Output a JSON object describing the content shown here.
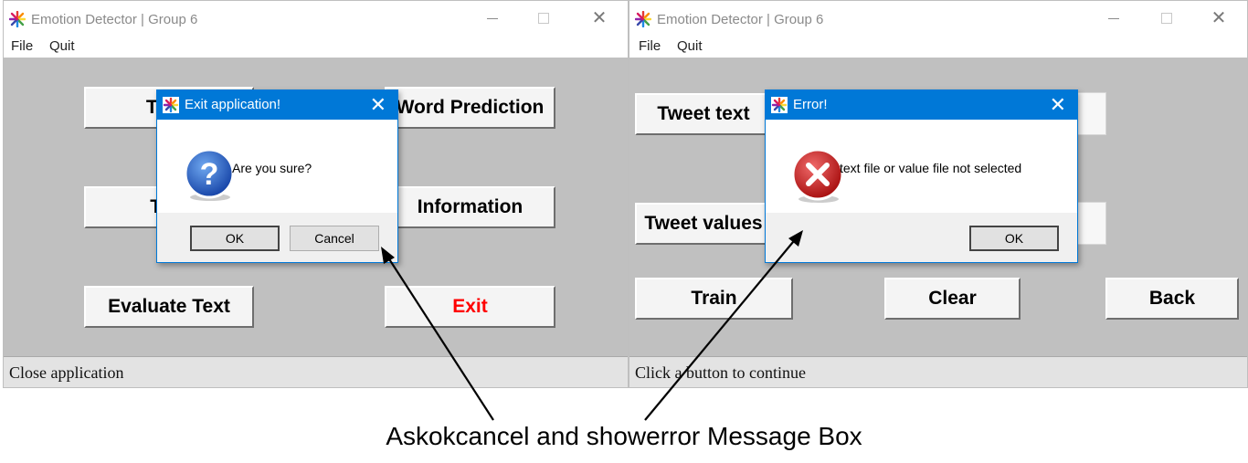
{
  "left_window": {
    "title": "Emotion Detector | Group 6",
    "menu": [
      "File",
      "Quit"
    ],
    "buttons": {
      "train": "Train",
      "word_prediction": "Word Prediction",
      "test": "Test",
      "information": "Information",
      "evaluate_text": "Evaluate Text",
      "exit": "Exit"
    },
    "status": "Close application"
  },
  "right_window": {
    "title": "Emotion Detector | Group 6",
    "menu": [
      "File",
      "Quit"
    ],
    "buttons": {
      "tweet_text": "Tweet text",
      "tweet_values": "Tweet values",
      "train": "Train",
      "clear": "Clear",
      "back": "Back"
    },
    "status": "Click a button to continue"
  },
  "exit_dialog": {
    "title": "Exit application!",
    "message": "Are you sure?",
    "ok": "OK",
    "cancel": "Cancel",
    "icon": "question-icon"
  },
  "error_dialog": {
    "title": "Error!",
    "message": "text file or value file not selected",
    "ok": "OK",
    "icon": "error-icon"
  },
  "caption": "Askokcancel and showerror Message Box",
  "colors": {
    "exit_text": "#ff0000",
    "dialog_title_bg": "#0078d7",
    "window_bg": "#c0c0c0"
  }
}
